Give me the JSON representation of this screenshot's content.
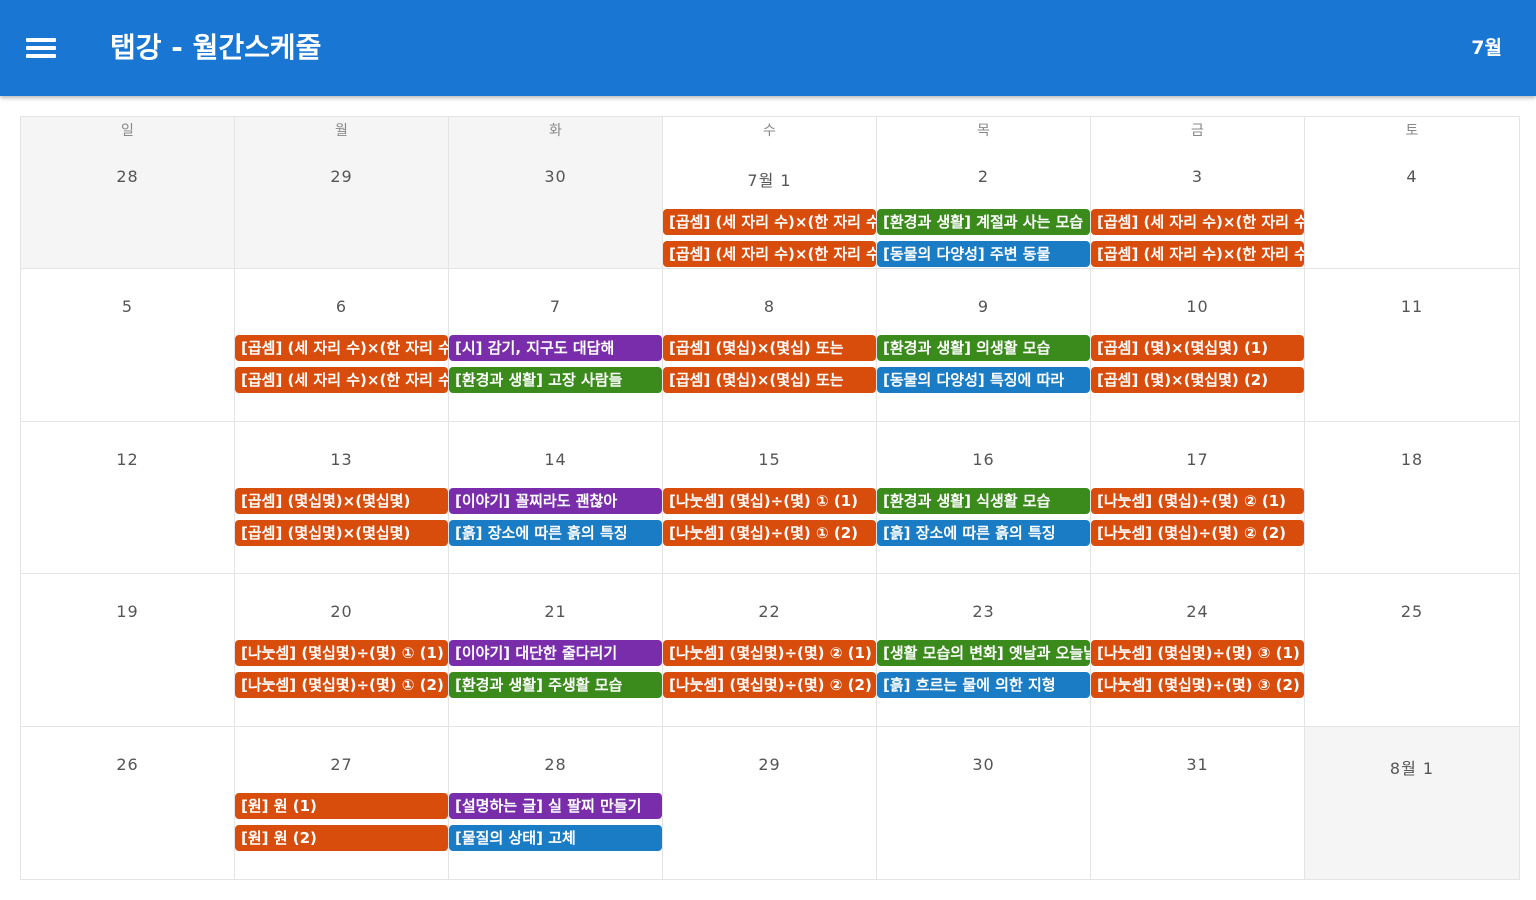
{
  "appbar": {
    "title": "탭강 - 월간스케줄",
    "month_button": "7월"
  },
  "colors": {
    "appbar": "#1976d2",
    "orange": "#d84d0b",
    "green": "#3a8a1c",
    "blue": "#1a7cc4",
    "purple": "#7a2dab"
  },
  "weekdays": [
    "일",
    "월",
    "화",
    "수",
    "목",
    "금",
    "토"
  ],
  "weeks": [
    [
      {
        "date": "28",
        "outside": true,
        "events": []
      },
      {
        "date": "29",
        "outside": true,
        "events": []
      },
      {
        "date": "30",
        "outside": true,
        "events": []
      },
      {
        "date": "7월 1",
        "outside": false,
        "events": [
          {
            "text": "[곱셈] (세 자리 수)×(한 자리 수)",
            "color": "orange"
          },
          {
            "text": "[곱셈] (세 자리 수)×(한 자리 수)",
            "color": "orange"
          }
        ]
      },
      {
        "date": "2",
        "outside": false,
        "events": [
          {
            "text": "[환경과 생활] 계절과 사는 모습",
            "color": "green"
          },
          {
            "text": "[동물의 다양성] 주변 동물",
            "color": "blue"
          }
        ]
      },
      {
        "date": "3",
        "outside": false,
        "events": [
          {
            "text": "[곱셈] (세 자리 수)×(한 자리 수)",
            "color": "orange"
          },
          {
            "text": "[곱셈] (세 자리 수)×(한 자리 수)",
            "color": "orange"
          }
        ]
      },
      {
        "date": "4",
        "outside": false,
        "events": []
      }
    ],
    [
      {
        "date": "5",
        "outside": false,
        "events": []
      },
      {
        "date": "6",
        "outside": false,
        "events": [
          {
            "text": "[곱셈] (세 자리 수)×(한 자리 수)",
            "color": "orange"
          },
          {
            "text": "[곱셈] (세 자리 수)×(한 자리 수)",
            "color": "orange"
          }
        ]
      },
      {
        "date": "7",
        "outside": false,
        "events": [
          {
            "text": "[시] 감기, 지구도 대답해",
            "color": "purple"
          },
          {
            "text": "[환경과 생활] 고장 사람들",
            "color": "green"
          }
        ]
      },
      {
        "date": "8",
        "outside": false,
        "events": [
          {
            "text": "[곱셈] (몇십)×(몇십) 또는",
            "color": "orange"
          },
          {
            "text": "[곱셈] (몇십)×(몇십) 또는",
            "color": "orange"
          }
        ]
      },
      {
        "date": "9",
        "outside": false,
        "events": [
          {
            "text": "[환경과 생활] 의생활 모습",
            "color": "green"
          },
          {
            "text": "[동물의 다양성] 특징에 따라",
            "color": "blue"
          }
        ]
      },
      {
        "date": "10",
        "outside": false,
        "events": [
          {
            "text": "[곱셈] (몇)×(몇십몇) (1)",
            "color": "orange"
          },
          {
            "text": "[곱셈] (몇)×(몇십몇) (2)",
            "color": "orange"
          }
        ]
      },
      {
        "date": "11",
        "outside": false,
        "events": []
      }
    ],
    [
      {
        "date": "12",
        "outside": false,
        "events": []
      },
      {
        "date": "13",
        "outside": false,
        "events": [
          {
            "text": "[곱셈] (몇십몇)×(몇십몇)",
            "color": "orange"
          },
          {
            "text": "[곱셈] (몇십몇)×(몇십몇)",
            "color": "orange"
          }
        ]
      },
      {
        "date": "14",
        "outside": false,
        "events": [
          {
            "text": "[이야기] 꼴찌라도 괜찮아",
            "color": "purple"
          },
          {
            "text": "[흙] 장소에 따른 흙의 특징",
            "color": "blue"
          }
        ]
      },
      {
        "date": "15",
        "outside": false,
        "events": [
          {
            "text": "[나눗셈] (몇십)÷(몇) ① (1)",
            "color": "orange"
          },
          {
            "text": "[나눗셈] (몇십)÷(몇) ① (2)",
            "color": "orange"
          }
        ]
      },
      {
        "date": "16",
        "outside": false,
        "events": [
          {
            "text": "[환경과 생활] 식생활 모습",
            "color": "green"
          },
          {
            "text": "[흙] 장소에 따른 흙의 특징",
            "color": "blue"
          }
        ]
      },
      {
        "date": "17",
        "outside": false,
        "events": [
          {
            "text": "[나눗셈] (몇십)÷(몇) ② (1)",
            "color": "orange"
          },
          {
            "text": "[나눗셈] (몇십)÷(몇) ② (2)",
            "color": "orange"
          }
        ]
      },
      {
        "date": "18",
        "outside": false,
        "events": []
      }
    ],
    [
      {
        "date": "19",
        "outside": false,
        "events": []
      },
      {
        "date": "20",
        "outside": false,
        "events": [
          {
            "text": "[나눗셈] (몇십몇)÷(몇) ① (1)",
            "color": "orange"
          },
          {
            "text": "[나눗셈] (몇십몇)÷(몇) ① (2)",
            "color": "orange"
          }
        ]
      },
      {
        "date": "21",
        "outside": false,
        "events": [
          {
            "text": "[이야기] 대단한 줄다리기",
            "color": "purple"
          },
          {
            "text": "[환경과 생활] 주생활 모습",
            "color": "green"
          }
        ]
      },
      {
        "date": "22",
        "outside": false,
        "events": [
          {
            "text": "[나눗셈] (몇십몇)÷(몇) ② (1)",
            "color": "orange"
          },
          {
            "text": "[나눗셈] (몇십몇)÷(몇) ② (2)",
            "color": "orange"
          }
        ]
      },
      {
        "date": "23",
        "outside": false,
        "events": [
          {
            "text": "[생활 모습의 변화] 옛날과 오늘날",
            "color": "green"
          },
          {
            "text": "[흙] 흐르는 물에 의한 지형",
            "color": "blue"
          }
        ]
      },
      {
        "date": "24",
        "outside": false,
        "events": [
          {
            "text": "[나눗셈] (몇십몇)÷(몇) ③ (1)",
            "color": "orange"
          },
          {
            "text": "[나눗셈] (몇십몇)÷(몇) ③ (2)",
            "color": "orange"
          }
        ]
      },
      {
        "date": "25",
        "outside": false,
        "events": []
      }
    ],
    [
      {
        "date": "26",
        "outside": false,
        "events": []
      },
      {
        "date": "27",
        "outside": false,
        "events": [
          {
            "text": "[원] 원 (1)",
            "color": "orange"
          },
          {
            "text": "[원] 원 (2)",
            "color": "orange"
          }
        ]
      },
      {
        "date": "28",
        "outside": false,
        "events": [
          {
            "text": "[설명하는 글] 실 팔찌 만들기",
            "color": "purple"
          },
          {
            "text": "[물질의 상태] 고체",
            "color": "blue"
          }
        ]
      },
      {
        "date": "29",
        "outside": false,
        "events": []
      },
      {
        "date": "30",
        "outside": false,
        "events": []
      },
      {
        "date": "31",
        "outside": false,
        "events": []
      },
      {
        "date": "8월 1",
        "outside": true,
        "events": []
      }
    ]
  ]
}
